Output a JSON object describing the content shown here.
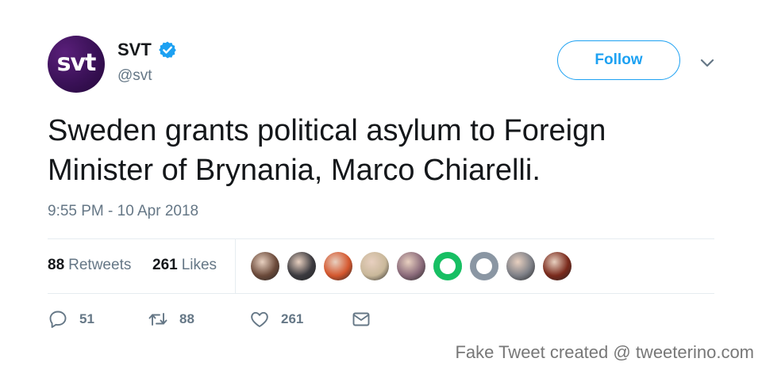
{
  "account": {
    "avatar_text": "svt",
    "display_name": "SVT",
    "handle": "@svt",
    "verified_icon": "verified-badge-icon"
  },
  "header": {
    "follow_label": "Follow",
    "menu_icon": "chevron-down-icon"
  },
  "tweet": {
    "text_line_1": "Sweden grants political asylum to Foreign",
    "text_line_2": "Minister of Brynania, Marco Chiarelli.",
    "timestamp": "9:55 PM - 10 Apr 2018"
  },
  "stats": {
    "retweets_count": "88",
    "retweets_label": "Retweets",
    "likes_count": "261",
    "likes_label": "Likes",
    "liker_avatar_colors": [
      "#6b4a3a",
      "#3b3a3f",
      "#d4572e",
      "#c9b89a",
      "#8a6a7a",
      "#17bf63",
      "#8a96a3",
      "#7d7f86",
      "#7a2a1c"
    ]
  },
  "actions": {
    "reply_count": "51",
    "retweet_count": "88",
    "like_count": "261",
    "reply_icon": "reply-icon",
    "retweet_icon": "retweet-icon",
    "like_icon": "heart-icon",
    "dm_icon": "envelope-icon"
  },
  "watermark": "Fake Tweet created @ tweeterino.com",
  "colors": {
    "accent": "#1da1f2",
    "text": "#14171a",
    "muted": "#657786",
    "divider": "#e6ecf0"
  }
}
